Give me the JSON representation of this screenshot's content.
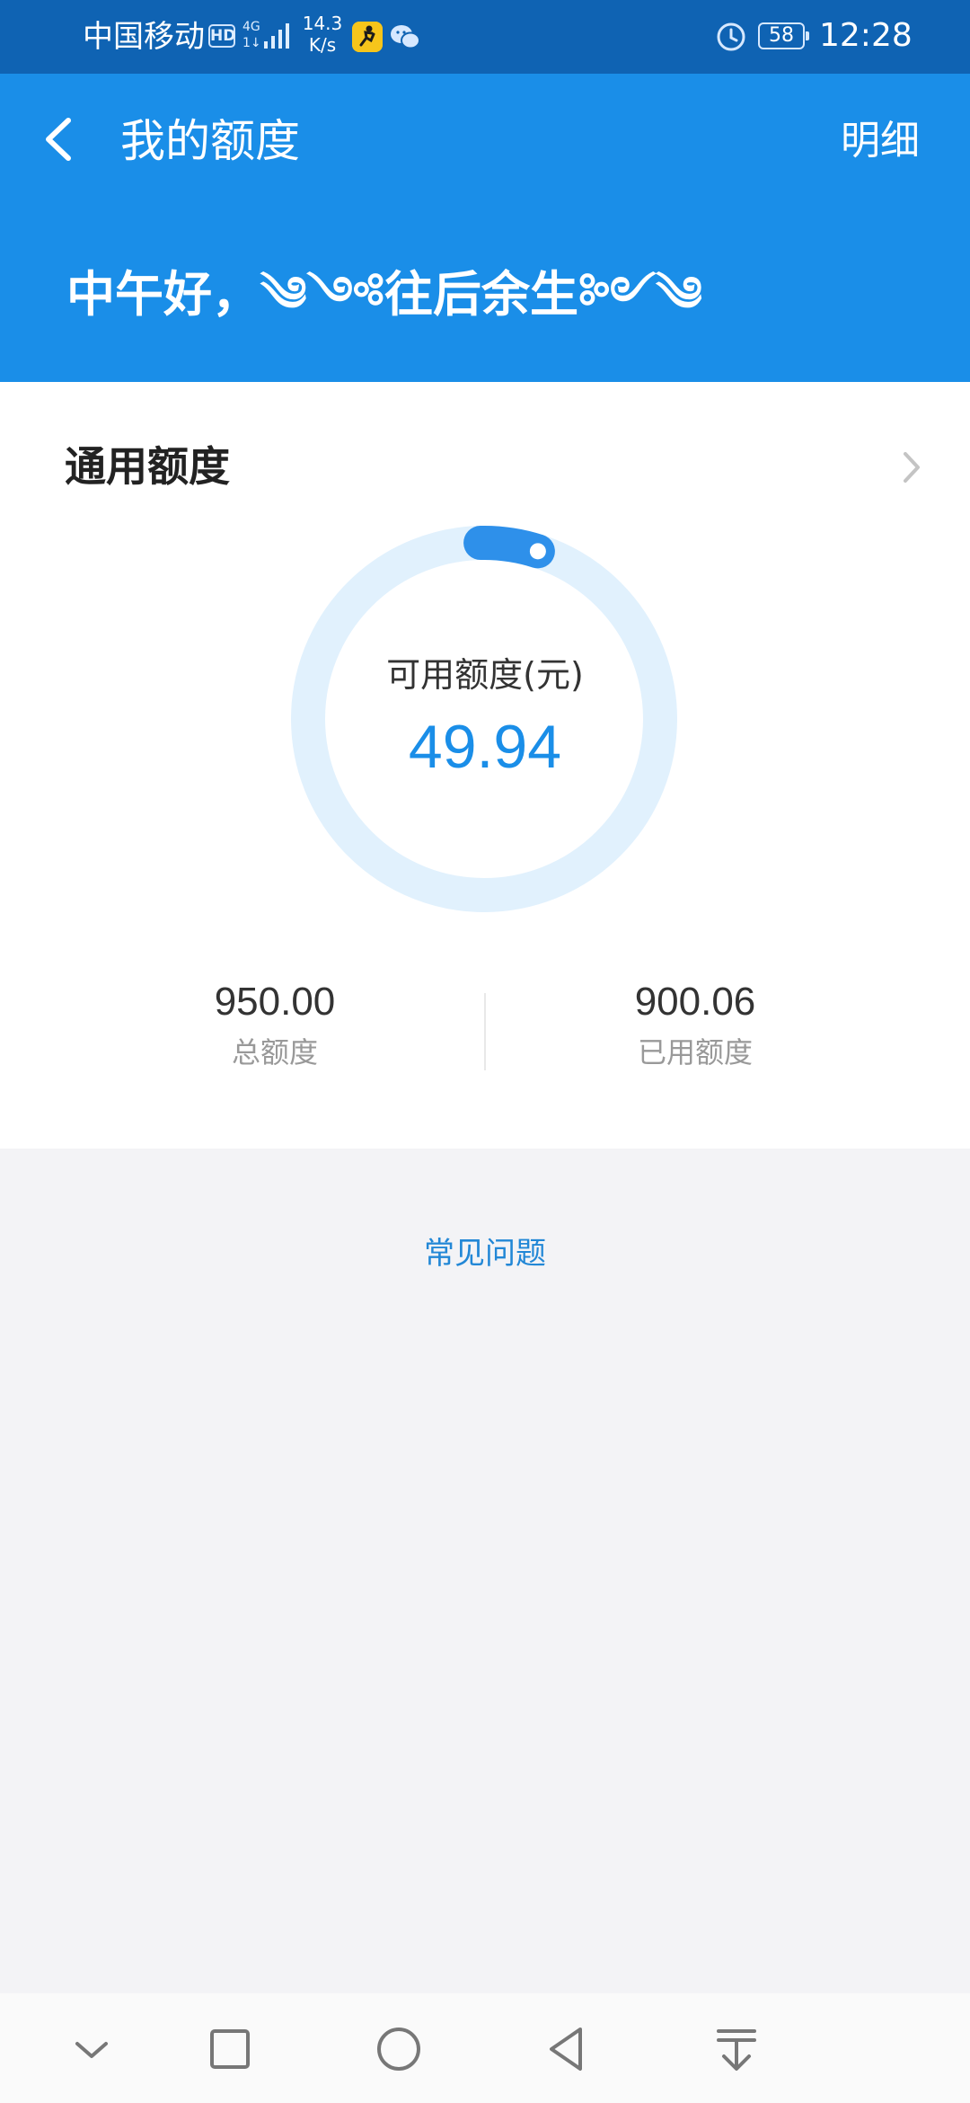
{
  "status_bar": {
    "carrier": "中国移动",
    "hd_badge": "HD",
    "network_type": "4G",
    "network_sub": "1↓",
    "speed_value": "14.3",
    "speed_unit": "K/s",
    "battery": "58",
    "time": "12:28"
  },
  "header": {
    "title": "我的额度",
    "detail_link": "明细",
    "greeting": "中午好，༄༺往后余生༻༄"
  },
  "credit_card": {
    "title": "通用额度",
    "available_label": "可用额度(元)",
    "available_value": "49.94",
    "total_value": "950.00",
    "total_label": "总额度",
    "used_value": "900.06",
    "used_label": "已用额度",
    "available_fraction": 0.0526
  },
  "faq": {
    "label": "常见问题"
  },
  "colors": {
    "status_bar_bg": "#0f63b3",
    "header_bg": "#1a8ee8",
    "accent": "#1a8ee8",
    "ring_track": "#e1f1fd",
    "page_bg": "#f3f3f6"
  },
  "nav_icons": [
    "chevron-down-icon",
    "square-icon",
    "circle-icon",
    "triangle-back-icon",
    "download-icon"
  ]
}
